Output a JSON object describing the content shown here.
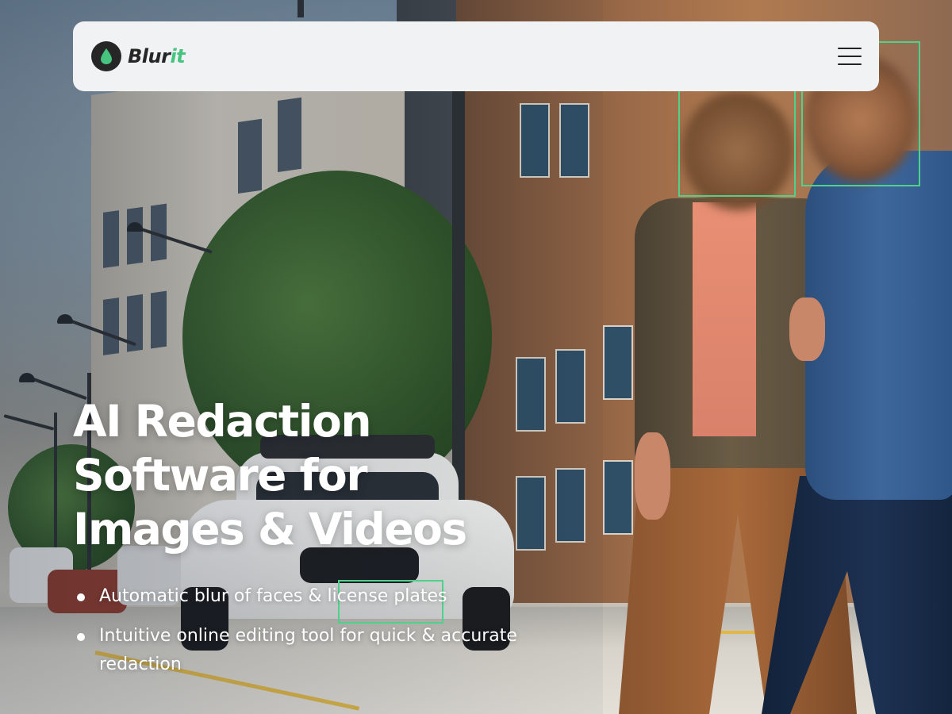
{
  "nav": {
    "logo": {
      "icon": "water-drop-icon",
      "text_main": "Blur",
      "text_accent": "it"
    },
    "menu_icon": "hamburger-menu-icon"
  },
  "hero": {
    "headline_lines": [
      "AI Redaction",
      "Software for",
      "Images & Videos"
    ],
    "features": [
      "Automatic blur of faces & license plates",
      "Intuitive online editing tool for quick & accurate redaction"
    ]
  },
  "colors": {
    "accent": "#47c47f",
    "detection_box": "#4fd18b",
    "nav_bg": "#f1f2f4",
    "logo_dark": "#262626",
    "headline": "#ffffff"
  }
}
